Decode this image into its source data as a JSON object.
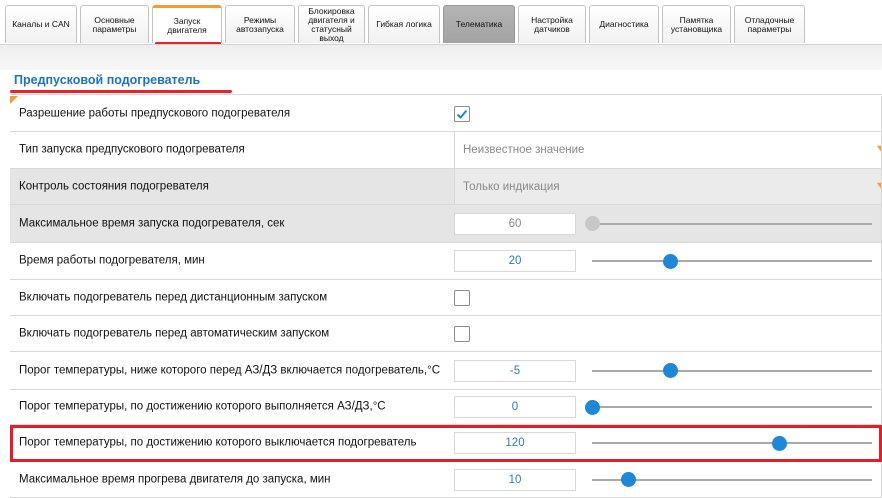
{
  "tabs": [
    {
      "label": "Каналы и CAN",
      "state": "normal"
    },
    {
      "label": "Основные параметры",
      "state": "normal"
    },
    {
      "label": "Запуск двигателя",
      "state": "active"
    },
    {
      "label": "Режимы автозапуска",
      "state": "normal"
    },
    {
      "label": "Блокировка двигателя и статусный выход",
      "state": "normal"
    },
    {
      "label": "Гибкая логика",
      "state": "normal"
    },
    {
      "label": "Телематика",
      "state": "gray"
    },
    {
      "label": "Настройка датчиков",
      "state": "normal"
    },
    {
      "label": "Диагностика",
      "state": "normal"
    },
    {
      "label": "Памятка установщика",
      "state": "normal"
    },
    {
      "label": "Отладочные параметры",
      "state": "normal"
    }
  ],
  "section": {
    "title": "Предпусковой подогреватель"
  },
  "rows": [
    {
      "label": "Разрешение работы предпускового подогревателя",
      "control": "checkbox",
      "checked": true
    },
    {
      "label": "Тип запуска предпускового подогревателя",
      "control": "select",
      "value": "Неизвестное значение"
    },
    {
      "label": "Контроль состояния подогревателя",
      "control": "select",
      "value": "Только индикация",
      "disabled": true
    },
    {
      "label": "Максимальное время запуска подогревателя, сек",
      "control": "slider",
      "value": "60",
      "level": 0.0,
      "disabled": true
    },
    {
      "label": "Время работы подогревателя, мин",
      "control": "slider",
      "value": "20",
      "level": 0.28
    },
    {
      "label": "Включать подогреватель перед дистанционным запуском",
      "control": "checkbox",
      "checked": false
    },
    {
      "label": "Включать подогреватель перед автоматическим запуском",
      "control": "checkbox",
      "checked": false
    },
    {
      "label": "Порог температуры, ниже которого перед АЗ/ДЗ включается подогреватель,°C",
      "control": "slider",
      "value": "-5",
      "level": 0.28
    },
    {
      "label": "Порог температуры, по достижению которого выполняется АЗ/ДЗ,°C",
      "control": "slider",
      "value": "0",
      "level": 0.0
    },
    {
      "label": "Порог температуры, по достижению которого выключается подогреватель",
      "control": "slider",
      "value": "120",
      "level": 0.67,
      "highlighted": true
    },
    {
      "label": "Максимальное время прогрева двигателя до запуска, мин",
      "control": "slider",
      "value": "10",
      "level": 0.13
    }
  ],
  "colors": {
    "accent": "#1e88d6",
    "tab_accent": "#f39c34",
    "annotation": "#e41e26",
    "title": "#1b73c3"
  }
}
